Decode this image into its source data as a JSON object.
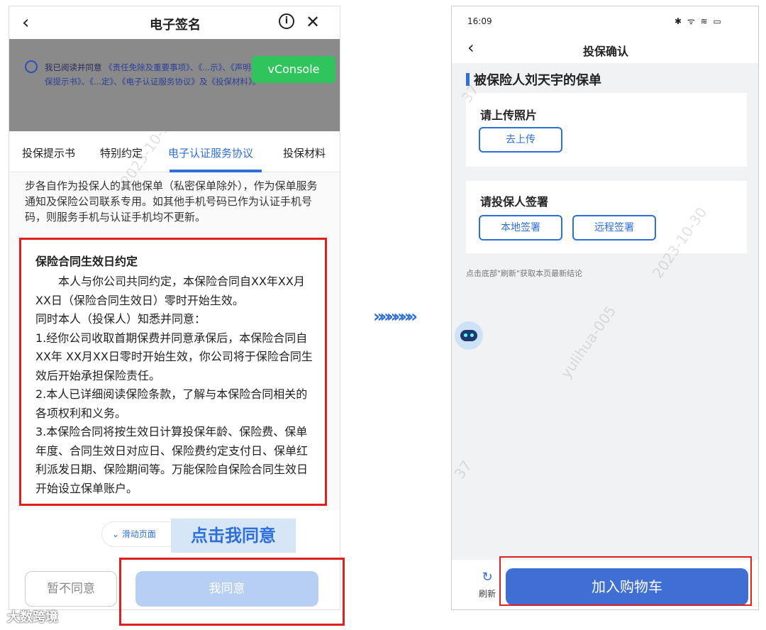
{
  "left": {
    "title": "电子签名",
    "back_icon": "‹",
    "info_icon": "i",
    "close_icon": "✕",
    "agree_text_1": "我已阅读并同意",
    "agree_links": "《责任免除及重要事项》、《...示》、《声明与授权》、《投保提示书》、《...定》、《电子认证服务协议》及《投保材料》。",
    "vconsole": "vConsole",
    "tabs": [
      "投保提示书",
      "特别约定",
      "电子认证服务协议",
      "投保材料"
    ],
    "paragraph": "步各自作为投保人的其他保单（私密保单除外），作为保单服务通知及保险公司联系专用。如其他手机号码已作为认证手机号码，则服务手机与认证手机均不更新。",
    "clause_title": "保险合同生效日约定",
    "clause_lines": [
      "　　本人与你公司共同约定，本保险合同自XX年XX月XX日（保险合同生效日）零时开始生效。",
      "同时本人（投保人）知悉并同意：",
      "1.经你公司收取首期保费并同意承保后，本保险合同自XX年 XX月XX日零时开始生效，你公司将于保险合同生效后开始承担保险责任。",
      "2.本人已详细阅读保险条款，了解与本保险合同相关的各项权利和义务。",
      "3.本保险合同将按生效日计算投保年龄、保险费、保单年度、合同生效日对应日、保险费约定支付日、保单红利派发日期、保险期间等。万能保险自保险合同生效日开始设立保单账户。"
    ],
    "slide_hint": "滑动页面",
    "click_hint": "点击我同意",
    "btn_disagree": "暂不同意",
    "btn_agree": "我同意"
  },
  "brand": "大数跨境",
  "arrow": "»»»»»»",
  "right": {
    "time": "16:09",
    "status_icons": "✱ ᯤ ≋ ▭",
    "title": "投保确认",
    "back_icon": "‹",
    "section_title": "被保险人刘天宇的保单",
    "upload_label": "请上传照片",
    "upload_button": "去上传",
    "sign_label": "请投保人签署",
    "local_sign": "本地签署",
    "remote_sign": "远程签署",
    "hint": "点击底部\"刷新\"获取本页最新结论",
    "refresh_icon": "↻",
    "refresh_label": "刷新",
    "cart_button": "加入购物车"
  },
  "watermarks": [
    "2023-10-30",
    "yulihua-005",
    "37"
  ],
  "colors": {
    "accent": "#2f6fd8",
    "highlight_border": "#e02020",
    "vconsole": "#2fc45c"
  }
}
